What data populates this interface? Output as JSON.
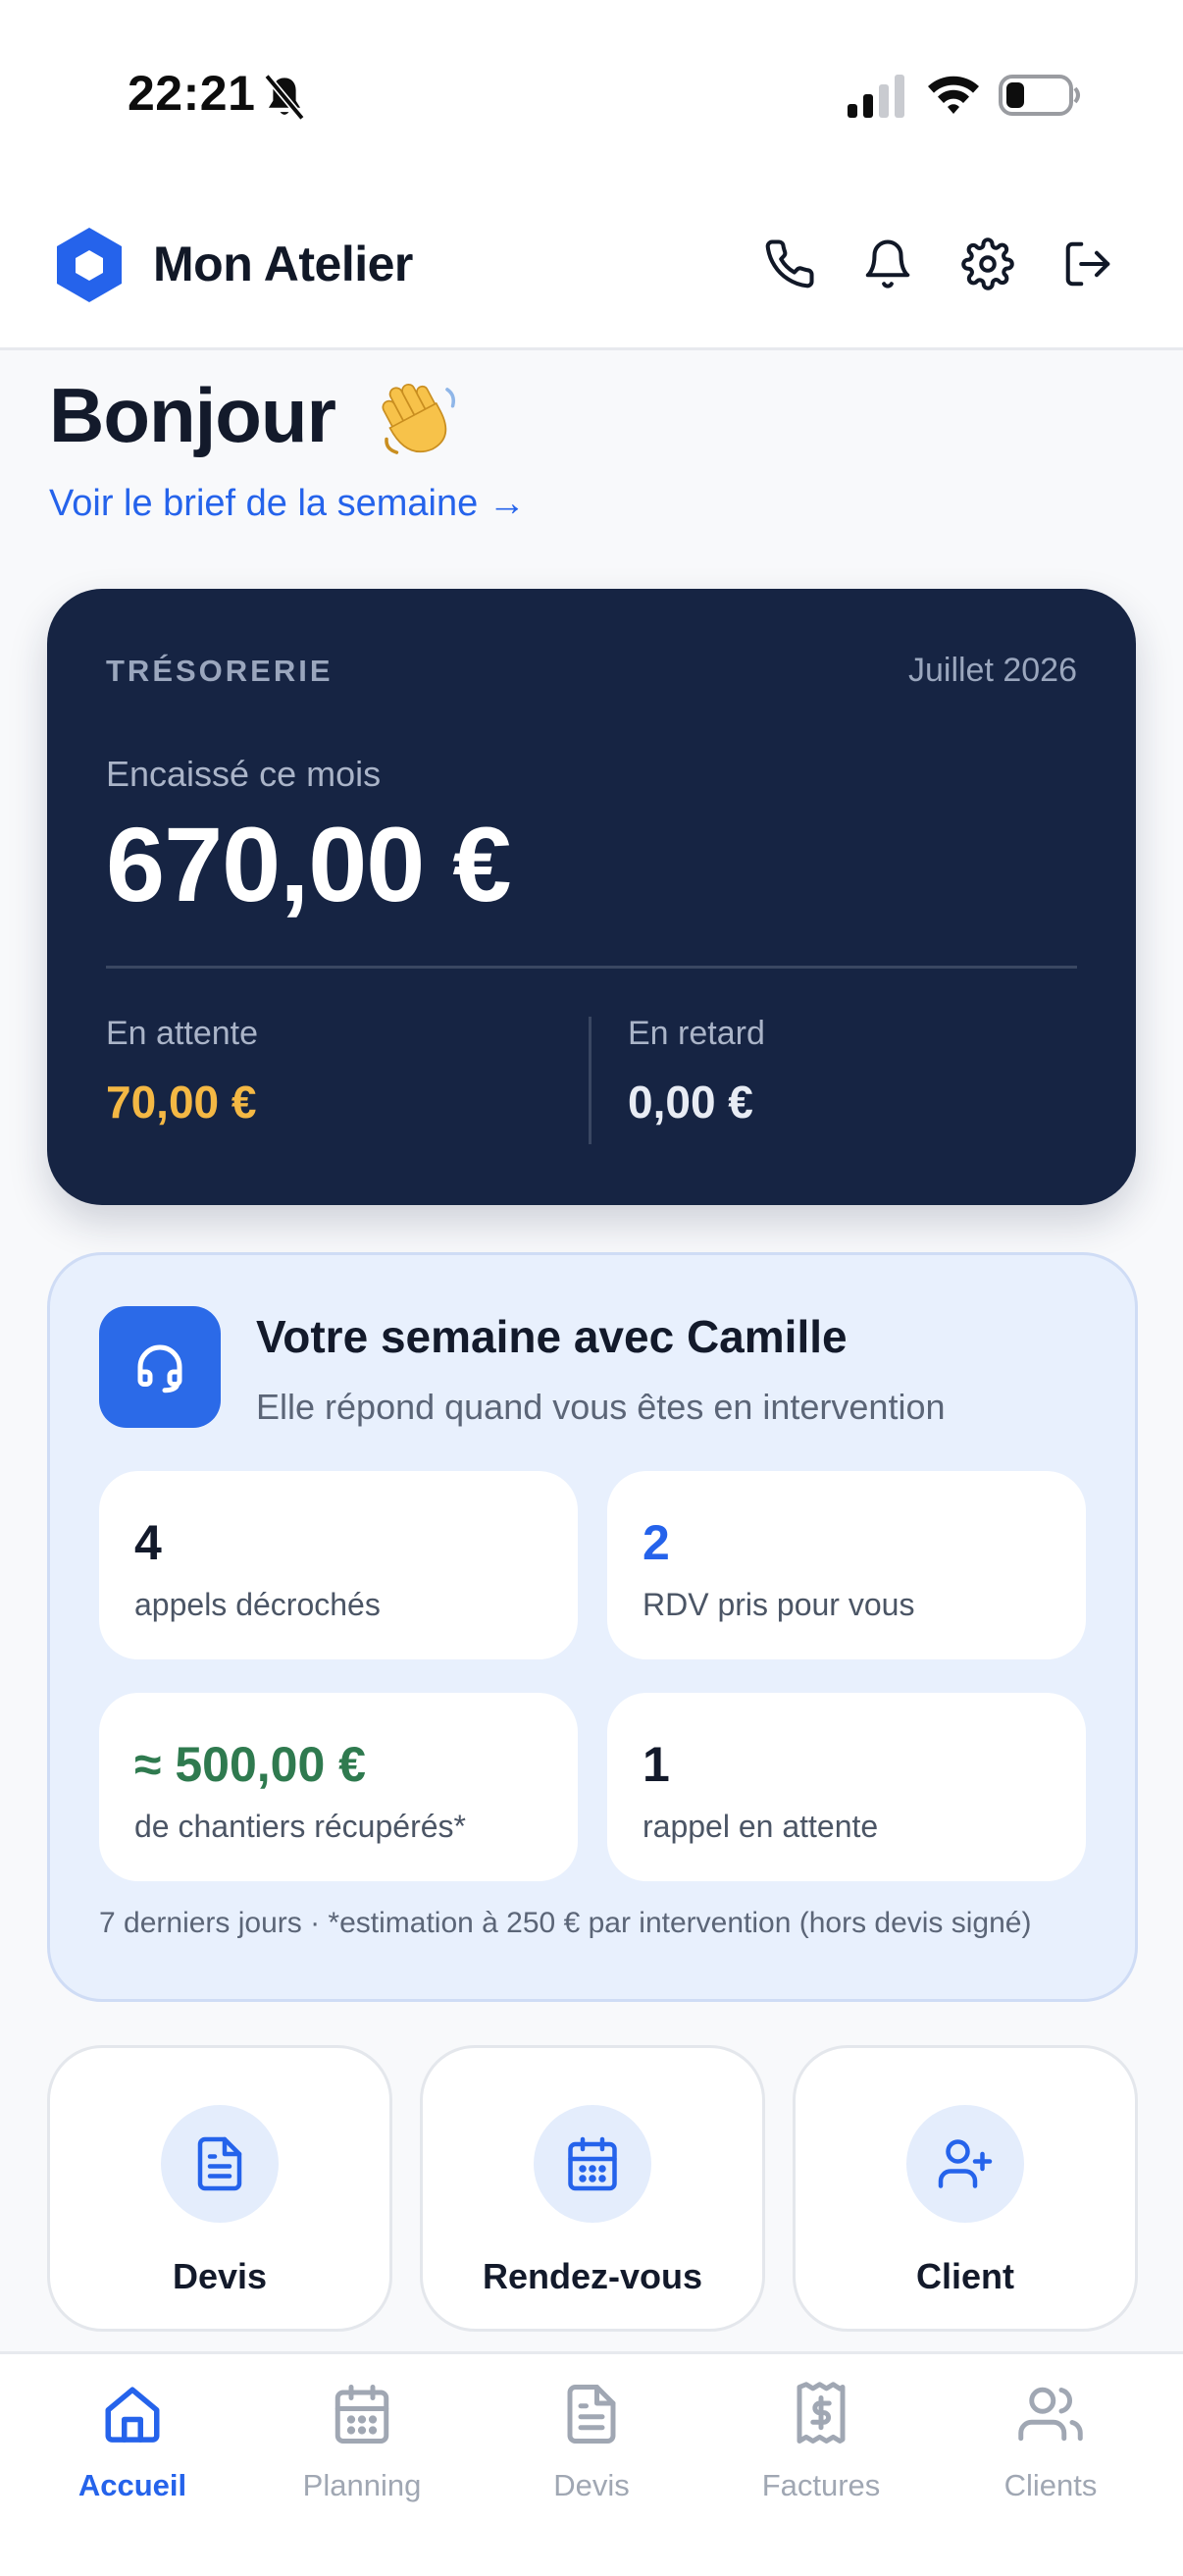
{
  "status_bar": {
    "time": "22:21"
  },
  "header": {
    "title": "Mon Atelier"
  },
  "greeting": {
    "title": "Bonjour",
    "brief_link": "Voir le brief de la semaine →"
  },
  "treasury": {
    "label": "TRÉSORERIE",
    "month": "Juillet 2026",
    "collected_label": "Encaissé ce mois",
    "collected_amount": "670,00 €",
    "pending_label": "En attente",
    "pending_amount": "70,00 €",
    "late_label": "En retard",
    "late_amount": "0,00 €"
  },
  "assistant": {
    "title": "Votre semaine avec Camille",
    "subtitle": "Elle répond quand vous êtes en intervention",
    "stats": [
      {
        "value": "4",
        "label": "appels décrochés",
        "color": "#131a2b"
      },
      {
        "value": "2",
        "label": "RDV pris pour vous",
        "color": "#2563eb"
      },
      {
        "value": "≈ 500,00 €",
        "label": "de chantiers récupérés*",
        "color": "#2f7a4f"
      },
      {
        "value": "1",
        "label": "rappel en attente",
        "color": "#131a2b"
      }
    ],
    "footnote": "7 derniers jours · *estimation à 250 € par intervention (hors devis signé)"
  },
  "quick_actions": [
    {
      "label": "Devis",
      "icon": "document-icon"
    },
    {
      "label": "Rendez-vous",
      "icon": "calendar-icon"
    },
    {
      "label": "Client",
      "icon": "user-plus-icon"
    }
  ],
  "bottom_nav": [
    {
      "label": "Accueil",
      "icon": "home-icon",
      "active": true
    },
    {
      "label": "Planning",
      "icon": "calendar-icon",
      "active": false
    },
    {
      "label": "Devis",
      "icon": "document-icon",
      "active": false
    },
    {
      "label": "Factures",
      "icon": "invoice-icon",
      "active": false
    },
    {
      "label": "Clients",
      "icon": "users-icon",
      "active": false
    }
  ],
  "colors": {
    "accent": "#2563eb",
    "treasury_bg": "#162443",
    "pending": "#f4b844",
    "recovered": "#2f7a4f"
  }
}
